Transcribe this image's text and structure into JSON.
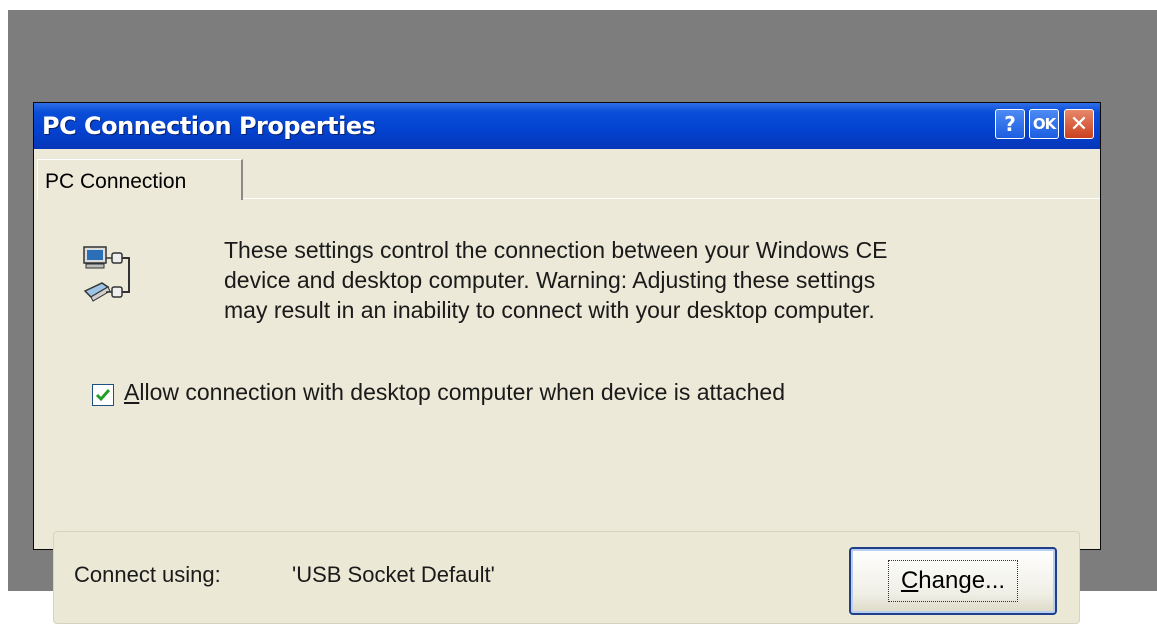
{
  "window": {
    "title": "PC Connection Properties",
    "help_label": "?",
    "ok_label": "OK",
    "close_label": "✕"
  },
  "tabs": [
    {
      "label": "PC Connection",
      "selected": true
    }
  ],
  "description": {
    "lines": [
      "These settings control the connection between your Windows CE",
      "device and desktop computer.  Warning: Adjusting these settings",
      "may result in an inability to connect with your desktop computer."
    ],
    "icon": "pc-connection-icon"
  },
  "allow_connection": {
    "mnemonic": "A",
    "label_rest": "llow connection with desktop computer when device is attached",
    "checked": true
  },
  "connect_using": {
    "label": "Connect using:",
    "value": "'USB Socket Default'"
  },
  "change_button": {
    "mnemonic": "C",
    "label_rest": "hange..."
  },
  "colors": {
    "titlebar": "#0342d0",
    "window_bg": "#ece9d8",
    "desktop_bg": "#7d7d7d",
    "check_green": "#21a121"
  }
}
